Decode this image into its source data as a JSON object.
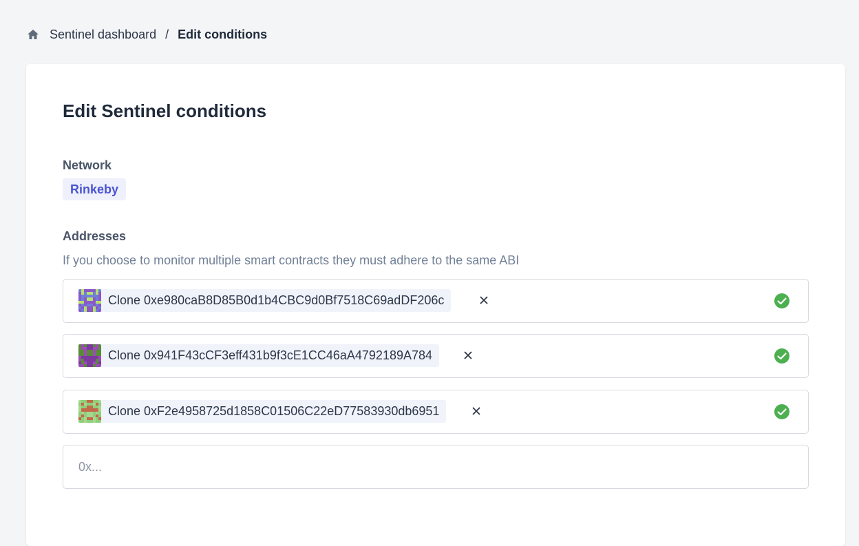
{
  "breadcrumb": {
    "home_icon": "home-icon",
    "parent": "Sentinel dashboard",
    "separator": "/",
    "current": "Edit conditions"
  },
  "card": {
    "title": "Edit Sentinel conditions"
  },
  "network": {
    "label": "Network",
    "value": "Rinkeby",
    "badge_color": "#4a54d1"
  },
  "addresses": {
    "label": "Addresses",
    "help": "If you choose to monitor multiple smart contracts they must adhere to the same ABI",
    "items": [
      {
        "text": "Clone 0xe980caB8D85B0d1b4CBC9d0Bf7518C69adDF206c",
        "status": "valid",
        "avatar_colors": [
          "#6f7fd8",
          "#b6e070",
          "#8a58c8"
        ]
      },
      {
        "text": "Clone 0x941F43cCF3eff431b9f3cE1CC46aA4792189A784",
        "status": "valid",
        "avatar_colors": [
          "#9c4cb8",
          "#7b3a9c",
          "#5a8a3a"
        ]
      },
      {
        "text": "Clone 0xF2e4958725d1858C01506C22eD77583930db6951",
        "status": "valid",
        "avatar_colors": [
          "#8ed07a",
          "#c26a4a",
          "#a6d890"
        ]
      }
    ],
    "input_placeholder": "0x...",
    "valid_color": "#4caf50"
  }
}
